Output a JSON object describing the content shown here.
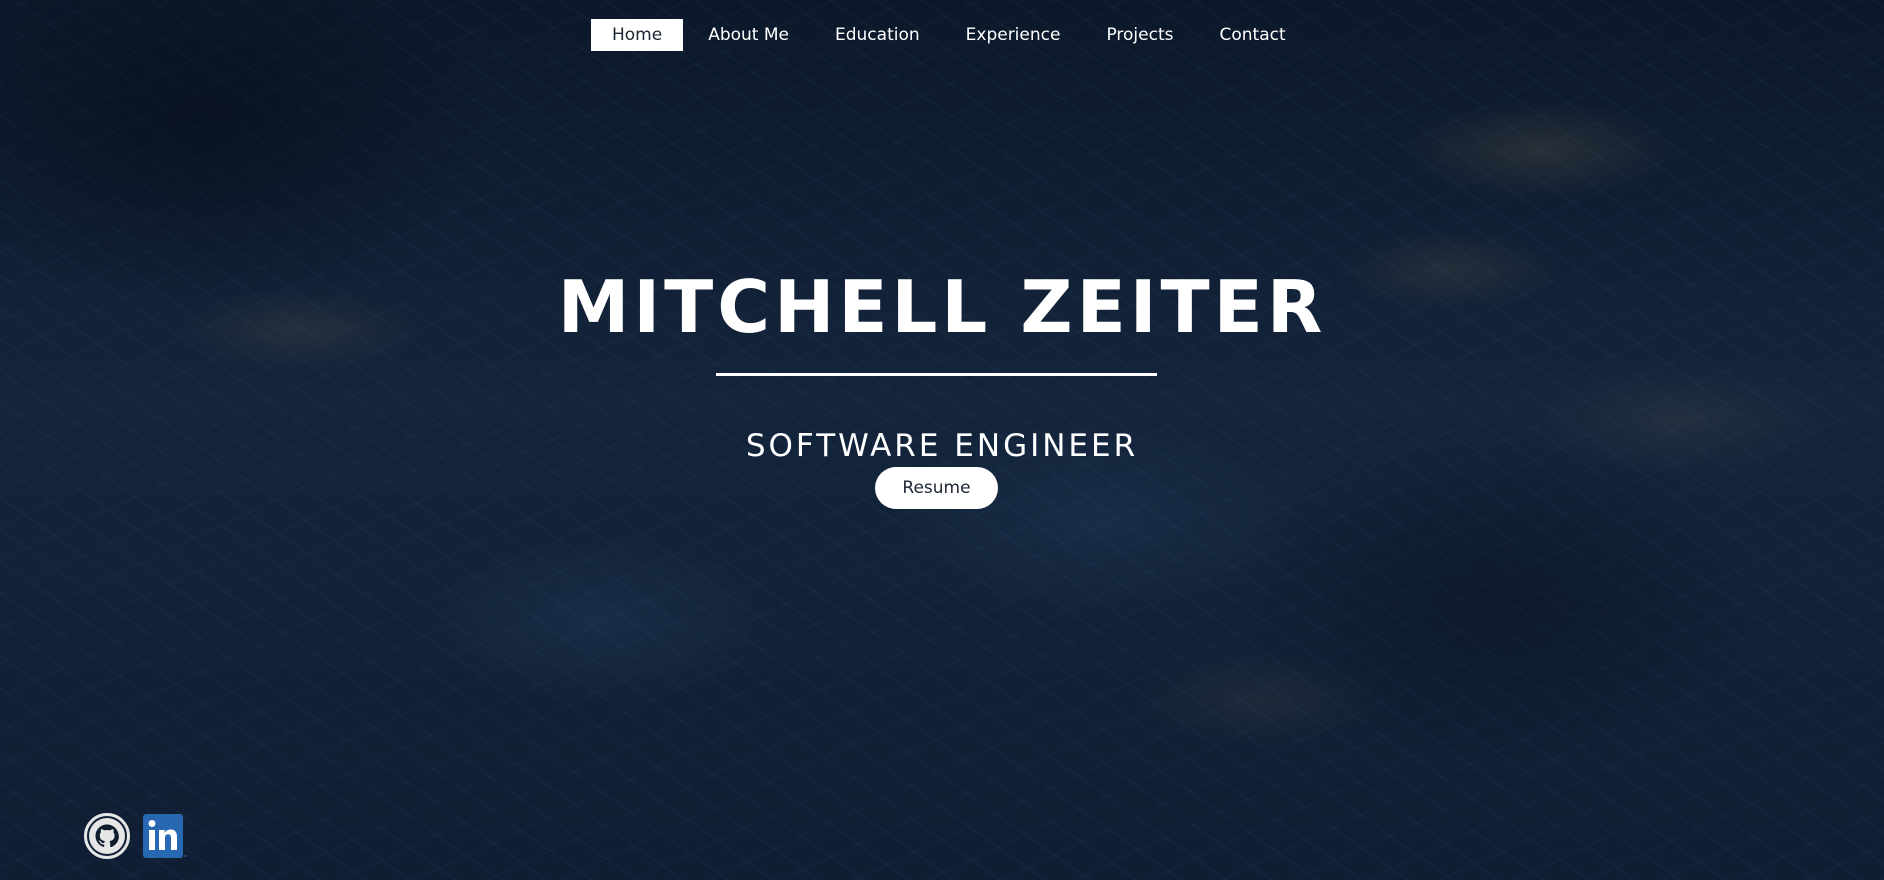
{
  "nav": {
    "items": [
      {
        "label": "Home",
        "active": true
      },
      {
        "label": "About Me",
        "active": false
      },
      {
        "label": "Education",
        "active": false
      },
      {
        "label": "Experience",
        "active": false
      },
      {
        "label": "Projects",
        "active": false
      },
      {
        "label": "Contact",
        "active": false
      }
    ]
  },
  "hero": {
    "name": "MITCHELL ZEITER",
    "subtitle": "SOFTWARE ENGINEER",
    "resume_label": "Resume"
  },
  "social": {
    "icons": [
      "github-icon",
      "linkedin-icon"
    ]
  },
  "colors": {
    "background": "#0d1a2c",
    "text": "#ffffff",
    "linkedin_blue": "#2867b2",
    "button_text": "#1b2433"
  }
}
